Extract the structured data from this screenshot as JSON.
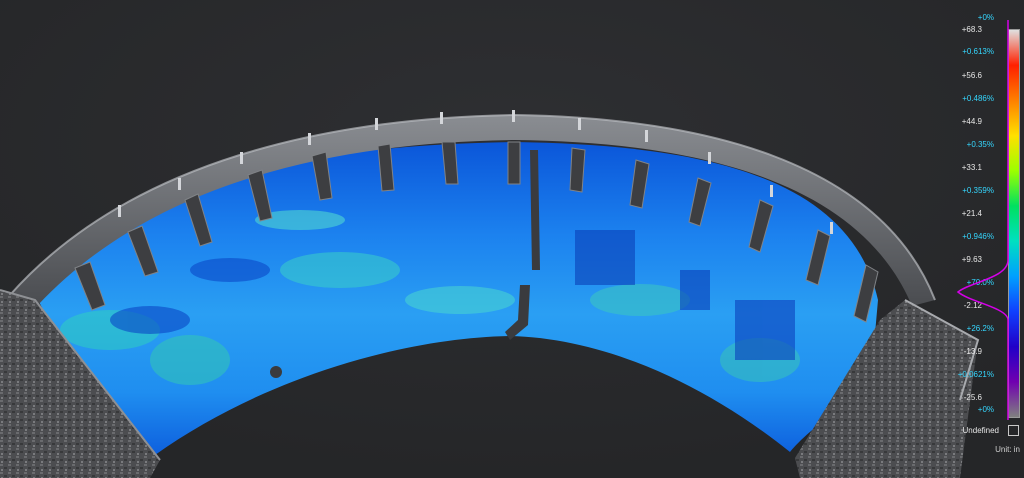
{
  "scale": {
    "value_labels": [
      "+68.3",
      "+56.6",
      "+44.9",
      "+33.1",
      "+21.4",
      "+9.63",
      "-2.12",
      "-13.9",
      "-25.6"
    ],
    "percent_labels": [
      "+0%",
      "+0.613%",
      "+0.486%",
      "+0.35%",
      "+0.359%",
      "+0.946%",
      "+70.0%",
      "+26.2%",
      "+0.0621%",
      "+0%"
    ],
    "undefined_label": "Undefined",
    "unit_label": "Unit: in",
    "colors": [
      "#e0e0e0",
      "#ff2000",
      "#ff8000",
      "#ffe000",
      "#9cff00",
      "#00e060",
      "#00e0c0",
      "#00a0ff",
      "#1040ff",
      "#2000c8",
      "#7000b0",
      "#808080"
    ],
    "histogram_color": "#d400e8"
  },
  "view": {
    "background": "#2b2c2e",
    "scan_colors": [
      "#0a4fd6",
      "#1a78f0",
      "#2ea6f2",
      "#35c3c0",
      "#1458e0"
    ]
  }
}
